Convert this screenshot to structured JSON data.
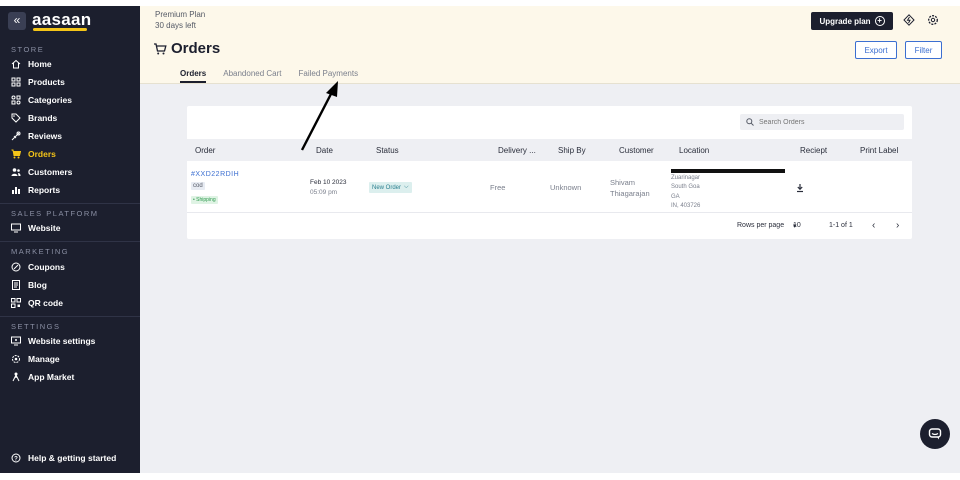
{
  "brand": {
    "name": "aasaan"
  },
  "sidebar": {
    "sections": [
      {
        "label": "STORE"
      },
      {
        "label": "SALES PLATFORM"
      },
      {
        "label": "MARKETING"
      },
      {
        "label": "SETTINGS"
      }
    ],
    "items": [
      {
        "label": "Home",
        "icon": "home-icon"
      },
      {
        "label": "Products",
        "icon": "grid-icon"
      },
      {
        "label": "Categories",
        "icon": "category-icon"
      },
      {
        "label": "Brands",
        "icon": "tag-icon"
      },
      {
        "label": "Reviews",
        "icon": "review-icon"
      },
      {
        "label": "Orders",
        "icon": "cart-icon",
        "active": true
      },
      {
        "label": "Customers",
        "icon": "users-icon"
      },
      {
        "label": "Reports",
        "icon": "chart-icon"
      },
      {
        "label": "Website",
        "icon": "monitor-icon"
      },
      {
        "label": "Coupons",
        "icon": "coupon-icon"
      },
      {
        "label": "Blog",
        "icon": "doc-icon"
      },
      {
        "label": "QR code",
        "icon": "qr-icon"
      },
      {
        "label": "Website settings",
        "icon": "settings-monitor-icon"
      },
      {
        "label": "Manage",
        "icon": "gear-icon"
      },
      {
        "label": "App Market",
        "icon": "apps-icon"
      }
    ],
    "help": {
      "label": "Help & getting started",
      "icon": "help-icon"
    }
  },
  "header": {
    "plan_name": "Premium Plan",
    "plan_days": "30 days left",
    "title": "Orders",
    "upgrade_label": "Upgrade plan",
    "export_label": "Export",
    "filter_label": "Filter",
    "tabs": [
      {
        "label": "Orders",
        "active": true
      },
      {
        "label": "Abandoned Cart"
      },
      {
        "label": "Failed Payments"
      }
    ]
  },
  "search": {
    "placeholder": "Search Orders"
  },
  "table": {
    "columns": [
      "Order",
      "Date",
      "Status",
      "Delivery ...",
      "Ship By",
      "Customer",
      "Location",
      "Reciept",
      "Print Label"
    ],
    "rows": [
      {
        "order_id": "#XXD22RDIH",
        "payment": "cod",
        "shipping_tag": "• Shipping",
        "date": "Feb 10 2023",
        "time": "05:09 pm",
        "status": "New Order",
        "delivery": "Free",
        "ship_by": "Unknown",
        "customer_first": "Shivam",
        "customer_last": "Thiagarajan",
        "location_lines": [
          "Zuarinagar",
          "South Goa",
          "GA",
          "IN, 403726"
        ]
      }
    ]
  },
  "pagination": {
    "rows_per_page_label": "Rows per page",
    "rows_per_page_value": "10",
    "range": "1-1 of 1"
  },
  "colors": {
    "sidebar_bg": "#1c1f2e",
    "accent_yellow": "#f5c518",
    "link_blue": "#3c6fd1",
    "topbar_bg": "#fdf8ea"
  }
}
